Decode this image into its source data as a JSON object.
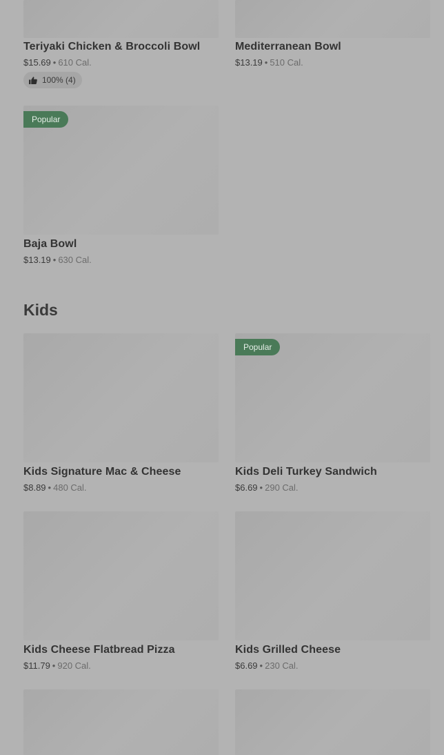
{
  "colors": {
    "background": "#b3b3b3",
    "popular_badge": "#4a7a58",
    "rating_pill": "#a6a6a6"
  },
  "top_items": [
    {
      "name": "Teriyaki Chicken & Broccoli Bowl",
      "price": "$15.69",
      "calories": "610 Cal.",
      "rating": "100% (4)",
      "rating_icon": "thumbs-up-icon"
    },
    {
      "name": "Mediterranean Bowl",
      "price": "$13.19",
      "calories": "510 Cal."
    },
    {
      "name": "Baja Bowl",
      "price": "$13.19",
      "calories": "630 Cal.",
      "badge": "Popular"
    }
  ],
  "separator": "•",
  "kids_section": {
    "title": "Kids",
    "items": [
      {
        "name": "Kids Signature Mac & Cheese",
        "price": "$8.89",
        "calories": "480 Cal."
      },
      {
        "name": "Kids Deli Turkey Sandwich",
        "price": "$6.69",
        "calories": "290 Cal.",
        "badge": "Popular"
      },
      {
        "name": "Kids Cheese Flatbread Pizza",
        "price": "$11.79",
        "calories": "920 Cal."
      },
      {
        "name": "Kids Grilled Cheese",
        "price": "$6.69",
        "calories": "230 Cal."
      },
      {
        "name": "",
        "price": "",
        "calories": ""
      },
      {
        "name": "",
        "price": "",
        "calories": ""
      }
    ]
  }
}
